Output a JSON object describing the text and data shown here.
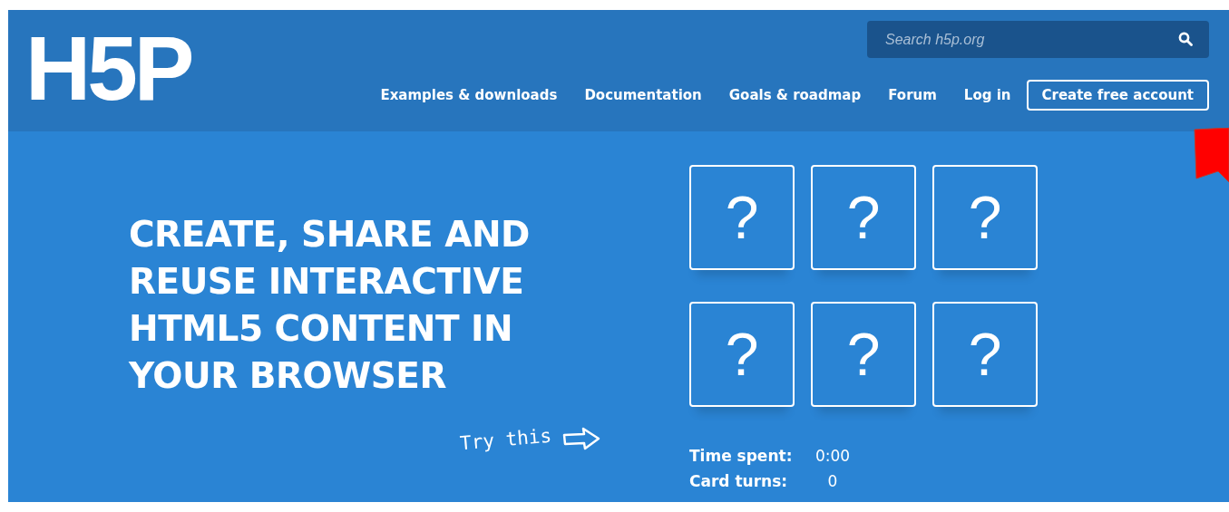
{
  "header": {
    "logo": "H5P",
    "search": {
      "placeholder": "Search h5p.org"
    },
    "nav": [
      {
        "label": "Examples & downloads",
        "kind": "link"
      },
      {
        "label": "Documentation",
        "kind": "link"
      },
      {
        "label": "Goals & roadmap",
        "kind": "link"
      },
      {
        "label": "Forum",
        "kind": "link"
      },
      {
        "label": "Log in",
        "kind": "link"
      },
      {
        "label": "Create free account",
        "kind": "button"
      }
    ]
  },
  "hero": {
    "title": "CREATE, SHARE AND REUSE INTERACTIVE HTML5 CONTENT IN YOUR BROWSER",
    "try_label": "Try this",
    "cards": [
      {
        "face": "?"
      },
      {
        "face": "?"
      },
      {
        "face": "?"
      },
      {
        "face": "?"
      },
      {
        "face": "?"
      },
      {
        "face": "?"
      }
    ],
    "stats": [
      {
        "label": "Time spent:",
        "value": "0:00"
      },
      {
        "label": "Card turns:",
        "value": "0"
      }
    ]
  }
}
